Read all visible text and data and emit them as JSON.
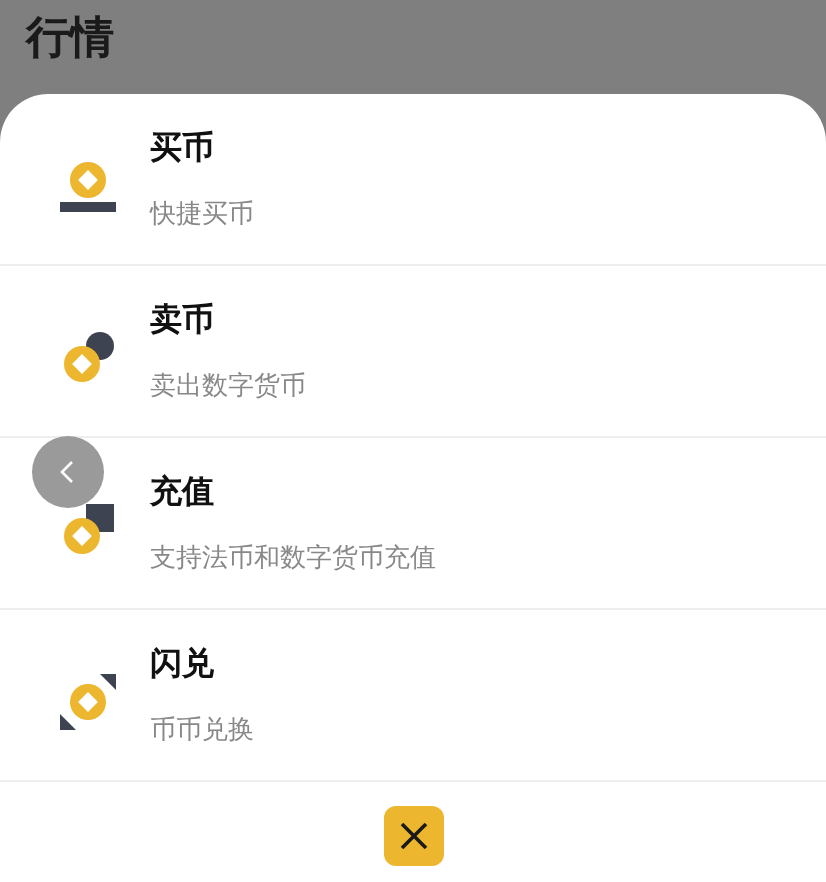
{
  "header": {
    "title": "行情"
  },
  "menu": [
    {
      "kind": "buy",
      "title": "买币",
      "subtitle": "快捷买币"
    },
    {
      "kind": "sell",
      "title": "卖币",
      "subtitle": "卖出数字货币"
    },
    {
      "kind": "deposit",
      "title": "充值",
      "subtitle": "支持法币和数字货币充值"
    },
    {
      "kind": "swap",
      "title": "闪兑",
      "subtitle": "币币兑换"
    }
  ]
}
